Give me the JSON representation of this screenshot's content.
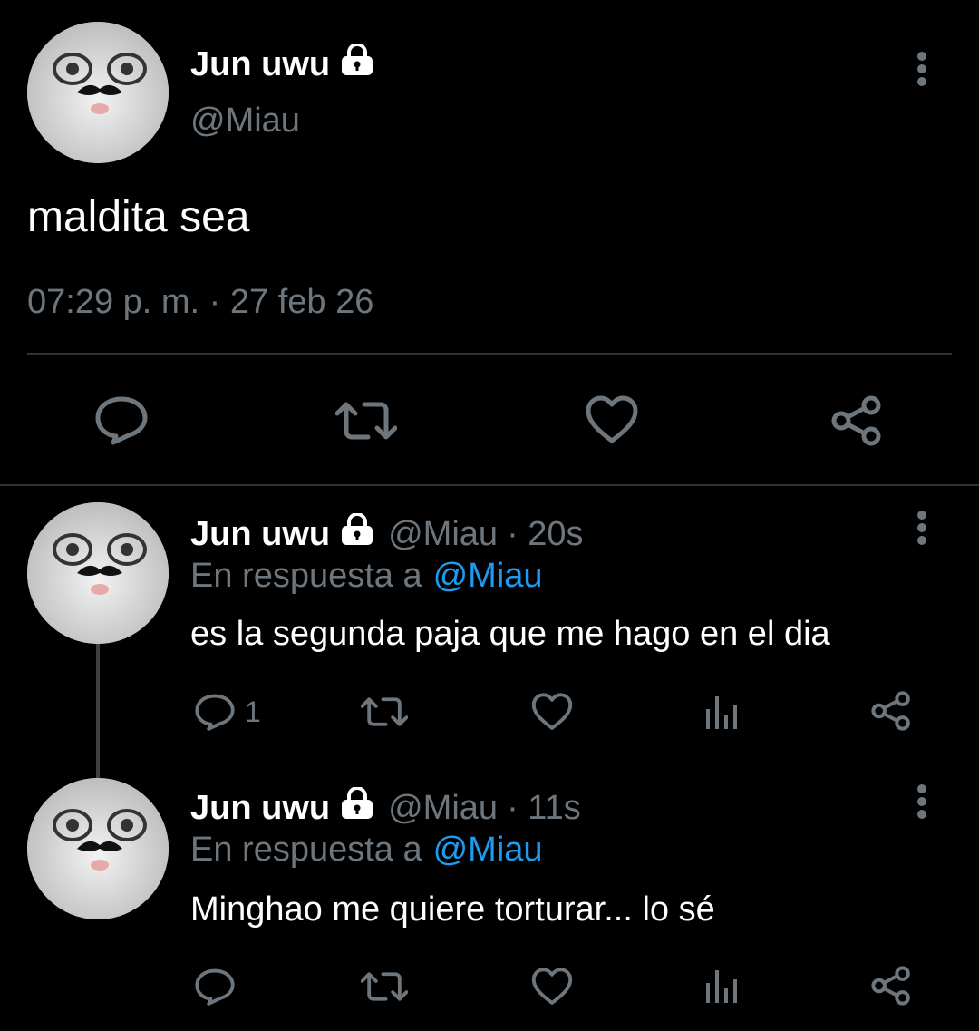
{
  "main_tweet": {
    "display_name": "Jun uwu",
    "handle": "@Miau",
    "text": "maldita sea",
    "timestamp": "07:29 p. m. · 27 feb 26"
  },
  "replies": [
    {
      "display_name": "Jun uwu",
      "handle": "@Miau",
      "time": "· 20s",
      "reply_to_prefix": "En respuesta a",
      "reply_to_handle": "@Miau",
      "text": "es la segunda paja que me hago en el dia",
      "reply_count": "1"
    },
    {
      "display_name": "Jun uwu",
      "handle": "@Miau",
      "time": "· 11s",
      "reply_to_prefix": "En respuesta a",
      "reply_to_handle": "@Miau",
      "text": "Minghao me quiere torturar... lo sé",
      "reply_count": ""
    }
  ],
  "icons": {
    "lock": "lock-icon",
    "more": "more-vertical-icon",
    "reply": "comment-icon",
    "retweet": "retweet-icon",
    "like": "heart-icon",
    "views": "analytics-icon",
    "share": "share-icon"
  },
  "colors": {
    "background": "#000000",
    "text": "#ffffff",
    "secondary": "#6e767d",
    "link": "#1d9bf0",
    "divider": "#2f3336"
  }
}
